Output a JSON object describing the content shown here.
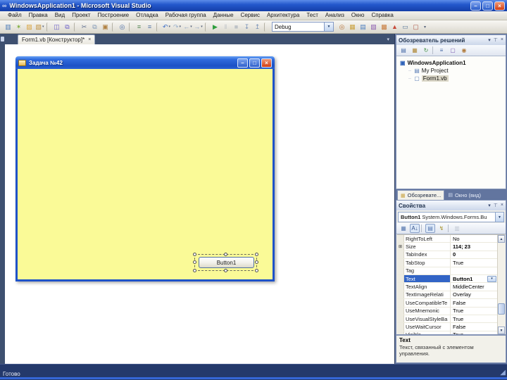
{
  "icons": {
    "logo": "∞",
    "min": "–",
    "max": "□",
    "close": "×",
    "dropdown": "▾",
    "pin": "⊤",
    "expander": "⊞",
    "grip": "◢",
    "up": "▲",
    "down": "▼",
    "chevron": "▾",
    "overflow": "▾"
  },
  "colors": {
    "titlebar_blue": "#2458cc",
    "form_yellow": "#fafa97",
    "selection_blue": "#3264c6",
    "doc_background": "#3e5070",
    "status_navy": "#24396b",
    "status_accent": "#3566d6"
  },
  "titlebar": {
    "title": "WindowsApplication1 - Microsoft Visual Studio"
  },
  "menu": {
    "items": [
      "Файл",
      "Правка",
      "Вид",
      "Проект",
      "Построение",
      "Отладка",
      "Рабочая группа",
      "Данные",
      "Сервис",
      "Архитектура",
      "Тест",
      "Анализ",
      "Окно",
      "Справка"
    ]
  },
  "toolbar": {
    "combo_value": "Debug",
    "icons_left": [
      {
        "name": "add-item-icon",
        "glyph": "▥",
        "color": "#4a7ab8"
      },
      {
        "name": "new-web-site-icon",
        "glyph": "✶",
        "color": "#7fae3e"
      },
      {
        "name": "open-file-icon",
        "glyph": "▨",
        "color": "#d9a33c"
      },
      {
        "name": "add-new-item-icon",
        "glyph": "▧",
        "color": "#c0903c",
        "dropdown": true
      },
      {
        "sep": true
      },
      {
        "name": "save-icon",
        "glyph": "◫",
        "color": "#6b5fc8"
      },
      {
        "name": "save-all-icon",
        "glyph": "⧉",
        "color": "#6b5fc8"
      },
      {
        "sep": true
      },
      {
        "name": "cut-icon",
        "glyph": "✂",
        "color": "#607090"
      },
      {
        "name": "copy-icon",
        "glyph": "⧉",
        "color": "#8098b8"
      },
      {
        "name": "paste-icon",
        "glyph": "▣",
        "color": "#b08040"
      },
      {
        "sep": true
      },
      {
        "name": "find-icon",
        "glyph": "◎",
        "color": "#4a6da8"
      },
      {
        "sep": true
      },
      {
        "name": "indent-icon",
        "glyph": "≡",
        "color": "#5a8a5a"
      },
      {
        "name": "outdent-icon",
        "glyph": "≡",
        "color": "#5a7aa8"
      },
      {
        "sep": true
      },
      {
        "name": "undo-icon",
        "glyph": "↶",
        "color": "#3a6cc8",
        "dropdown": true
      },
      {
        "name": "redo-icon",
        "glyph": "↷",
        "color": "#9ab0cc",
        "dropdown": true
      },
      {
        "name": "navigate-back-icon",
        "glyph": "←",
        "color": "#8aa0c4",
        "dropdown": true
      },
      {
        "name": "navigate-forward-icon",
        "glyph": "→",
        "color": "#8aa0c4",
        "dropdown": true
      },
      {
        "sep": true
      },
      {
        "name": "start-debug-icon",
        "glyph": "▶",
        "color": "#2e9e3e"
      },
      {
        "name": "pause-icon",
        "glyph": "‖",
        "color": "#9aa4b4",
        "disabled": true
      },
      {
        "name": "stop-icon",
        "glyph": "■",
        "color": "#9aa4b4",
        "disabled": true
      },
      {
        "name": "step-into-icon",
        "glyph": "↧",
        "color": "#7a92b8"
      },
      {
        "name": "step-over-icon",
        "glyph": "↥",
        "color": "#7a92b8"
      },
      {
        "sep": true
      }
    ],
    "icons_right": [
      {
        "name": "find-in-files-icon",
        "glyph": "◎",
        "color": "#b8743a"
      },
      {
        "name": "solution-explorer-icon",
        "glyph": "▦",
        "color": "#caa23e"
      },
      {
        "name": "properties-window-icon",
        "glyph": "▤",
        "color": "#4a7dc0"
      },
      {
        "name": "object-browser-icon",
        "glyph": "▧",
        "color": "#8a5ab0"
      },
      {
        "name": "toolbox-icon",
        "glyph": "▩",
        "color": "#c87a3a"
      },
      {
        "name": "error-list-icon",
        "glyph": "▲",
        "color": "#c84a3a"
      },
      {
        "name": "command-window-icon",
        "glyph": "▭",
        "color": "#5a7a9a"
      },
      {
        "name": "start-page-icon",
        "glyph": "▢",
        "color": "#b05a4a"
      }
    ]
  },
  "document": {
    "tab_label": "Form1.vb [Конструктор]*"
  },
  "designer_form": {
    "title": "Задача №42",
    "button_text": "Button1"
  },
  "solution_explorer": {
    "title": "Обозреватель решений",
    "toolbar_icons": [
      {
        "name": "se-properties-icon",
        "glyph": "▤",
        "color": "#4a6da8"
      },
      {
        "name": "show-all-files-icon",
        "glyph": "▦",
        "color": "#b08a3a"
      },
      {
        "name": "refresh-icon",
        "glyph": "↻",
        "color": "#3e8e3e"
      },
      {
        "sep": true
      },
      {
        "name": "view-code-icon",
        "glyph": "≡",
        "color": "#4a6da8"
      },
      {
        "name": "view-designer-icon",
        "glyph": "▢",
        "color": "#7a5ab0"
      },
      {
        "name": "class-diagram-icon",
        "glyph": "◉",
        "color": "#b07a3a"
      }
    ],
    "tree": [
      {
        "label": "WindowsApplication1",
        "glyph": "▣",
        "color": "#2f62b8",
        "root": true
      },
      {
        "label": "My Project",
        "glyph": "▤",
        "color": "#5d7fb6",
        "child": true
      },
      {
        "label": "Form1.vb",
        "glyph": "▢",
        "color": "#5d7fb6",
        "child": true,
        "selected": true
      }
    ]
  },
  "bottom_tabs": [
    {
      "label": "Обозревате...",
      "glyph": "▦",
      "color": "#c8a23e",
      "active": true
    },
    {
      "label": "Окно (вид)",
      "glyph": "▤",
      "color": "#cdd9ee"
    }
  ],
  "properties": {
    "title": "Свойства",
    "object_name": "Button1",
    "object_type": "System.Windows.Forms.Bu",
    "toolbar_icons": [
      {
        "name": "categorized-icon",
        "glyph": "▦",
        "color": "#5a7ab0"
      },
      {
        "name": "alphabetical-icon",
        "glyph": "A↓",
        "color": "#33518a",
        "active": true
      },
      {
        "sep": true
      },
      {
        "name": "properties-icon",
        "glyph": "▤",
        "color": "#5a7ab0",
        "active": true
      },
      {
        "name": "events-icon",
        "glyph": "↯",
        "color": "#a8922a"
      },
      {
        "sep": true
      },
      {
        "name": "property-pages-icon",
        "glyph": "▥",
        "color": "#9aa4b4",
        "disabled": true
      }
    ],
    "rows": [
      {
        "name": "RightToLeft",
        "value": "No"
      },
      {
        "name": "Size",
        "value": "114; 23",
        "expand": true,
        "bold": true
      },
      {
        "name": "TabIndex",
        "value": "0",
        "bold": true
      },
      {
        "name": "TabStop",
        "value": "True"
      },
      {
        "name": "Tag",
        "value": ""
      },
      {
        "name": "Text",
        "value": "Button1",
        "selected": true,
        "dropdown": true
      },
      {
        "name": "TextAlign",
        "value": "MiddleCenter"
      },
      {
        "name": "TextImageRelati",
        "value": "Overlay"
      },
      {
        "name": "UseCompatibleTe",
        "value": "False"
      },
      {
        "name": "UseMnemonic",
        "value": "True"
      },
      {
        "name": "UseVisualStyleBa",
        "value": "True"
      },
      {
        "name": "UseWaitCursor",
        "value": "False"
      },
      {
        "name": "Visible",
        "value": "True"
      }
    ],
    "description_title": "Text",
    "description_text": "Текст, связанный с элементом управления."
  },
  "statusbar": {
    "text": "Готово"
  }
}
